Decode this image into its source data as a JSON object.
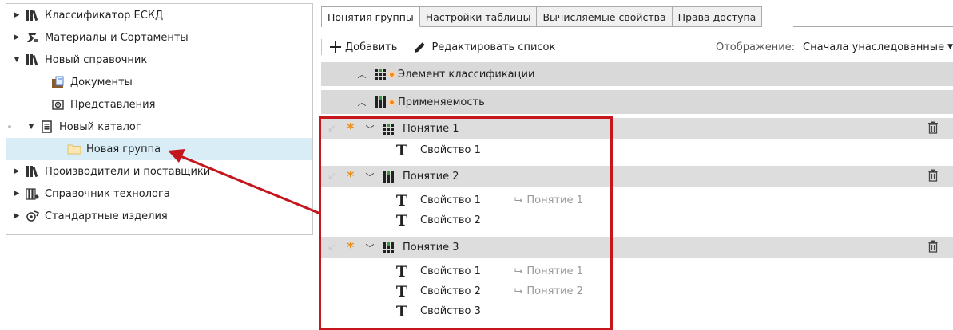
{
  "tree": {
    "items": [
      {
        "label": "Классификатор ЕСКД",
        "icon": "books-icon",
        "toggle": "collapsed"
      },
      {
        "label": "Материалы и Сортаменты",
        "icon": "materials-icon",
        "toggle": "collapsed"
      },
      {
        "label": "Новый справочник",
        "icon": "books-icon",
        "toggle": "expanded"
      },
      {
        "label": "Документы",
        "icon": "documents-folder-icon",
        "toggle": "none"
      },
      {
        "label": "Представления",
        "icon": "views-icon",
        "toggle": "none"
      },
      {
        "label": "Новый каталог",
        "icon": "catalog-icon",
        "toggle": "expanded"
      },
      {
        "label": "Новая группа",
        "icon": "folder-icon",
        "toggle": "none",
        "selected": true
      },
      {
        "label": "Производители и поставщики",
        "icon": "books-icon",
        "toggle": "collapsed"
      },
      {
        "label": "Справочник технолога",
        "icon": "technologist-books-icon",
        "toggle": "collapsed"
      },
      {
        "label": "Стандартные изделия",
        "icon": "standard-parts-icon",
        "toggle": "collapsed"
      }
    ]
  },
  "tabs": [
    {
      "label": "Понятия группы",
      "active": true
    },
    {
      "label": "Настройки таблицы",
      "active": false
    },
    {
      "label": "Вычисляемые свойства",
      "active": false
    },
    {
      "label": "Права доступа",
      "active": false
    }
  ],
  "toolbar": {
    "add_label": "Добавить",
    "edit_label": "Редактировать список",
    "display_label": "Отображение:",
    "display_value": "Сначала унаследованные"
  },
  "inherited_bands": [
    {
      "label": "Элемент классификации"
    },
    {
      "label": "Применяемость"
    }
  ],
  "concepts": [
    {
      "label": "Понятие 1",
      "properties": [
        {
          "label": "Свойство 1",
          "inherited_from": ""
        }
      ]
    },
    {
      "label": "Понятие 2",
      "properties": [
        {
          "label": "Свойство 1",
          "inherited_from": "Понятие 1"
        },
        {
          "label": "Свойство 2",
          "inherited_from": ""
        }
      ]
    },
    {
      "label": "Понятие 3",
      "properties": [
        {
          "label": "Свойство 1",
          "inherited_from": "Понятие 1"
        },
        {
          "label": "Свойство 2",
          "inherited_from": "Понятие 2"
        },
        {
          "label": "Свойство 3",
          "inherited_from": ""
        }
      ]
    }
  ],
  "colors": {
    "accent_red": "#c4161c",
    "star_orange": "#e8901a",
    "selected_row": "#d9edf7",
    "band_gray": "#d9d9d9"
  }
}
